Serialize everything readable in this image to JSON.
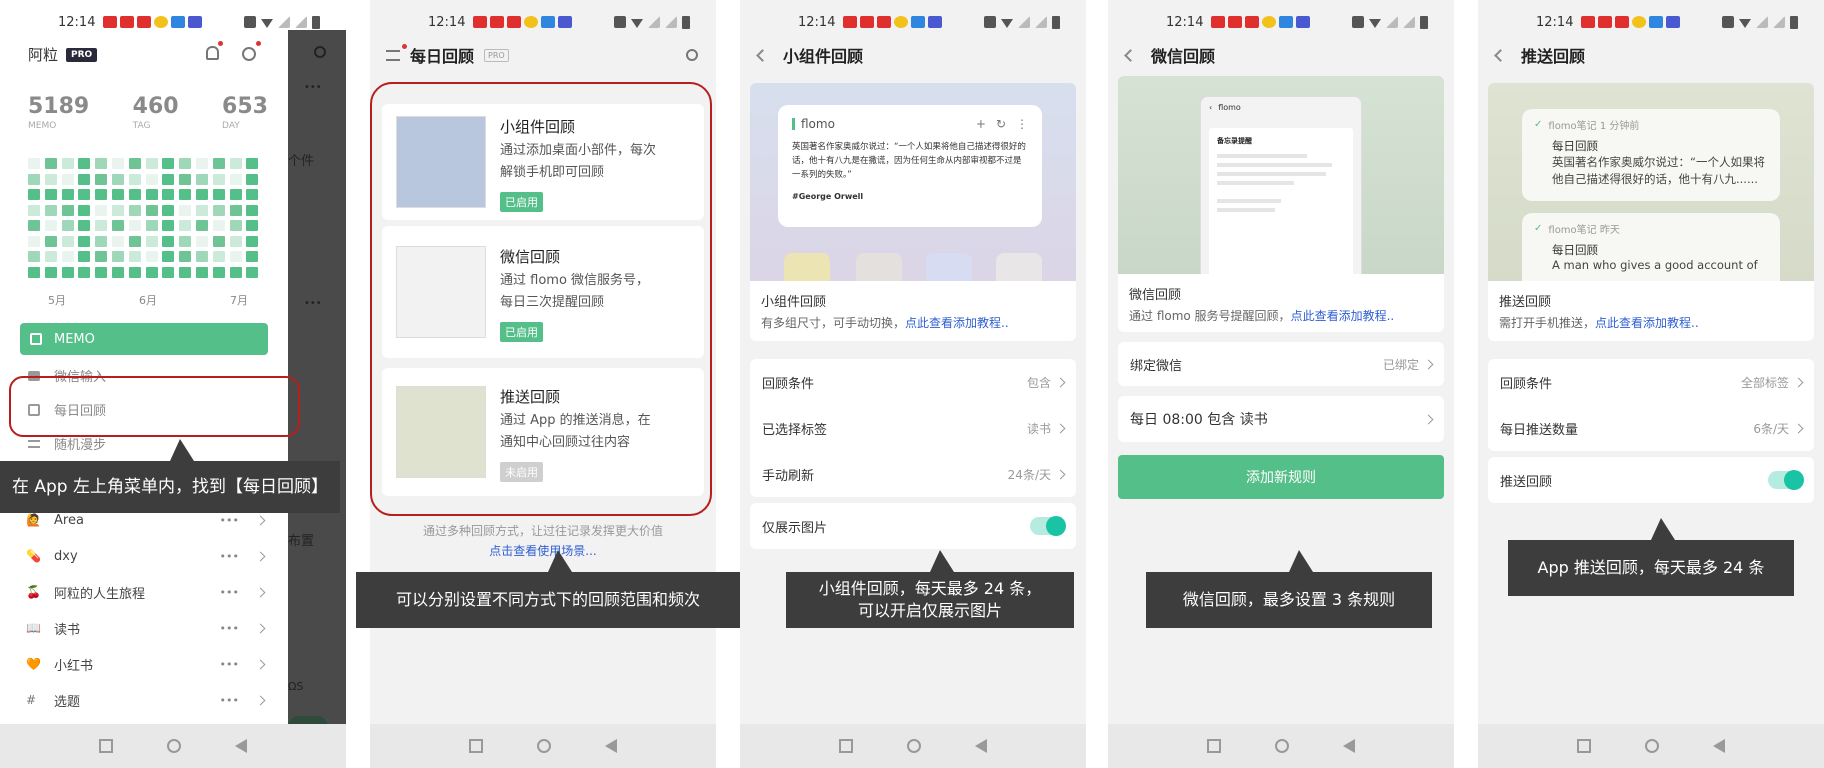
{
  "status": {
    "time": "12:14"
  },
  "panel1": {
    "user": "阿粒",
    "pro": "PRO",
    "stats": [
      {
        "value": "5189",
        "label": "MEMO"
      },
      {
        "value": "460",
        "label": "TAG"
      },
      {
        "value": "653",
        "label": "DAY"
      }
    ],
    "months": [
      "5月",
      "6月",
      "7月"
    ],
    "menu": [
      {
        "label": "MEMO"
      },
      {
        "label": "微信输入"
      },
      {
        "label": "每日回顾"
      },
      {
        "label": "随机漫步"
      }
    ],
    "tags": [
      {
        "emoji": "🙋",
        "label": "Area"
      },
      {
        "emoji": "💊",
        "label": "dxy"
      },
      {
        "emoji": "🍒",
        "label": "阿粒的人生旅程"
      },
      {
        "emoji": "📖",
        "label": "读书"
      },
      {
        "emoji": "🧡",
        "label": "小红书"
      },
      {
        "emoji": "#",
        "label": "选题"
      }
    ],
    "dots": "•••",
    "overlay_texts": [
      "个件",
      "布置",
      "ΩS"
    ],
    "caption": "在 App 左上角菜单内，找到【每日回顾】"
  },
  "panel2": {
    "title": "每日回顾",
    "pro": "PRO",
    "items": [
      {
        "title": "小组件回顾",
        "desc": "通过添加桌面小部件，每次解锁手机即可回顾",
        "badge": "已启用",
        "badge_color": "#55bf8a"
      },
      {
        "title": "微信回顾",
        "desc": "通过 flomo 微信服务号，每日三次提醒回顾",
        "badge": "已启用",
        "badge_color": "#55bf8a"
      },
      {
        "title": "推送回顾",
        "desc": "通过 App 的推送消息，在通知中心回顾过往内容",
        "badge": "未启用",
        "badge_color": "#cfcfcf"
      }
    ],
    "footer": "通过多种回顾方式，让过往记录发挥更大价值",
    "footer_link": "点击查看使用场景...",
    "caption": "可以分别设置不同方式下的回顾范围和频次"
  },
  "panel3": {
    "title": "小组件回顾",
    "widget_app": "flomo",
    "widget_text": "英国著名作家奥威尔说过：“一个人如果将他自己描述得很好的话，他十有八九是在撒谎，因为任何生命从内部审视都不过是一系列的失败。”",
    "widget_author": "#George Orwell",
    "card_title": "小组件回顾",
    "card_desc": "有多组尺寸，可手动切换，",
    "card_link": "点此查看添加教程..",
    "rows": [
      {
        "label": "回顾条件",
        "value": "包含"
      },
      {
        "label": "已选择标签",
        "value": "读书"
      },
      {
        "label": "手动刷新",
        "value": "24条/天"
      }
    ],
    "toggle_label": "仅展示图片",
    "caption": "小组件回顾，每天最多 24 条，\n可以开启仅展示图片"
  },
  "panel4": {
    "title": "微信回顾",
    "preview_app": "flomo",
    "preview_title": "备忘录提醒",
    "card_title": "微信回顾",
    "card_desc": "通过 flomo 服务号提醒回顾，",
    "card_link": "点此查看添加教程..",
    "bind_label": "绑定微信",
    "bind_value": "已绑定",
    "rule": "每日 08:00 包含 读书",
    "add_button": "添加新规则",
    "caption": "微信回顾，最多设置 3 条规则"
  },
  "panel5": {
    "title": "推送回顾",
    "notif1_head": "flomo笔记 1 分钟前",
    "notif1_title": "每日回顾",
    "notif1_body": "英国著名作家奥威尔说过：“一个人如果将他自己描述得很好的话，他十有八九......",
    "notif2_head": "flomo笔记 昨天",
    "notif2_title": "每日回顾",
    "notif2_body": "A man who gives a good account of",
    "card_title": "推送回顾",
    "card_desc": "需打开手机推送，",
    "card_link": "点此查看添加教程..",
    "rows": [
      {
        "label": "回顾条件",
        "value": "全部标签"
      },
      {
        "label": "每日推送数量",
        "value": "6条/天"
      }
    ],
    "toggle_label": "推送回顾",
    "caption": "App 推送回顾，每天最多 24 条"
  }
}
